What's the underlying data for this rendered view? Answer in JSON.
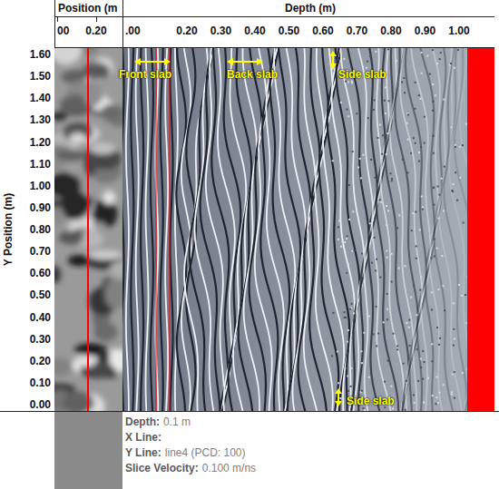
{
  "header": {
    "position_title": "Position (m",
    "depth_title": "Depth (m)",
    "position_ticks": [
      "00",
      "0.20"
    ],
    "depth_ticks": [
      ".00",
      "0.20",
      "0.30",
      "0.40",
      "0.50",
      "0.60",
      "0.70",
      "0.80",
      "0.90",
      "1.00"
    ]
  },
  "y_axis": {
    "title": "Y Position (m)",
    "ticks": [
      "1.60",
      "1.50",
      "1.40",
      "1.30",
      "1.20",
      "1.10",
      "1.00",
      "0.90",
      "0.80",
      "0.70",
      "0.60",
      "0.50",
      "0.40",
      "0.30",
      "0.20",
      "0.10",
      "0.00"
    ]
  },
  "annotations": [
    {
      "label": "Front slab",
      "kind": "horizontal"
    },
    {
      "label": "Back slab",
      "kind": "horizontal"
    },
    {
      "label": "Side slab",
      "kind": "vertical"
    },
    {
      "label": "Side slab",
      "kind": "vertical"
    }
  ],
  "info": [
    {
      "label": "Depth:",
      "value": "0.1 m"
    },
    {
      "label": "X Line:",
      "value": ""
    },
    {
      "label": "Y Line:",
      "value": "line4 (PCD: 100)"
    },
    {
      "label": "Slice Velocity:",
      "value": "0.100 m/ns"
    }
  ]
}
